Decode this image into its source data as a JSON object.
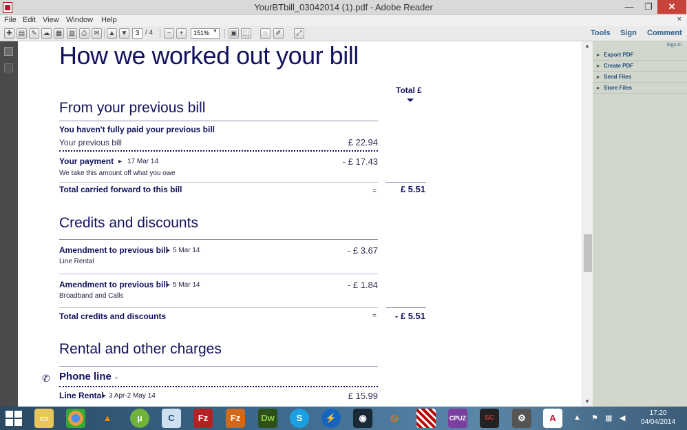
{
  "window": {
    "title": "YourBTbill_03042014 (1).pdf - Adobe Reader",
    "min": "—",
    "max": "❐",
    "close": "✕"
  },
  "menu": {
    "file": "File",
    "edit": "Edit",
    "view": "View",
    "window": "Window",
    "help": "Help",
    "close_x": "×"
  },
  "toolbar": {
    "page_current": "3",
    "page_total": "/ 4",
    "zoom": "151%",
    "tools": "Tools",
    "sign": "Sign",
    "comment": "Comment"
  },
  "right_pane": {
    "sign_in": "Sign In",
    "items": [
      "Export PDF",
      "Create PDF",
      "Send Files",
      "Store Files"
    ]
  },
  "document": {
    "title": "How we worked out your bill",
    "total_header": "Total £",
    "previous": {
      "heading": "From your previous bill",
      "not_paid": "You haven't fully paid your previous bill",
      "prev_bill_label": "Your previous bill",
      "prev_bill_amount": "£ 22.94",
      "payment_label": "Your payment",
      "payment_date": "17 Mar 14",
      "payment_amount": "- £ 17.43",
      "payment_note": "We take this amount off what you owe",
      "carried_label": "Total carried forward to this bill",
      "carried_eq": "=",
      "carried_total": "£ 5.51"
    },
    "credits": {
      "heading": "Credits and discounts",
      "item1_label": "Amendment to previous bill",
      "item1_date": "5 Mar 14",
      "item1_amount": "- £ 3.67",
      "item1_note": "Line Rental",
      "item2_label": "Amendment to previous bill",
      "item2_date": "5 Mar 14",
      "item2_amount": "- £ 1.84",
      "item2_note": "Broadband and Calls",
      "total_label": "Total credits and discounts",
      "total_eq": "=",
      "total_amount": "- £ 5.51"
    },
    "rental": {
      "heading": "Rental and other charges",
      "phone_line": "Phone line",
      "phone_line_dash": "-",
      "line_rental_label": "Line Rental",
      "line_rental_dates": "3 Apr-2 May 14",
      "line_rental_amount": "£ 15.99"
    }
  },
  "taskbar": {
    "time": "17:20",
    "date": "04/04/2014",
    "apps": [
      "file-explorer",
      "chrome",
      "vlc",
      "utorrent",
      "app-c",
      "filezilla",
      "filezilla-server",
      "dreamweaver",
      "skype",
      "lightning",
      "steam",
      "origin",
      "app-stripes",
      "cpu-z",
      "sc2",
      "settings",
      "adobe-reader"
    ]
  }
}
